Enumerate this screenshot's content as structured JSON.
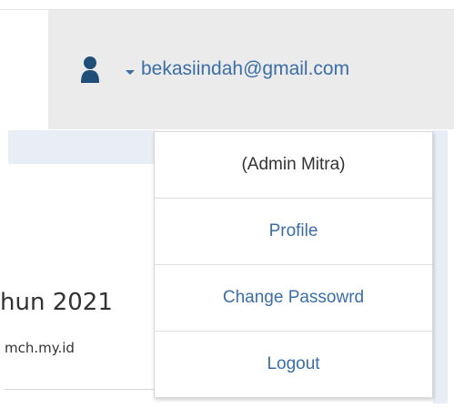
{
  "header": {
    "email": "bekasiindah@gmail.com",
    "icons": {
      "user": "user-icon",
      "caret": "caret-down-icon"
    },
    "accent_color": "#3a6ea5"
  },
  "page": {
    "heading": "hun 2021",
    "subtext": "mch.my.id"
  },
  "dropdown": {
    "role": "(Admin Mitra)",
    "items": [
      {
        "label": "Profile"
      },
      {
        "label": "Change Passowrd"
      },
      {
        "label": "Logout"
      }
    ]
  }
}
